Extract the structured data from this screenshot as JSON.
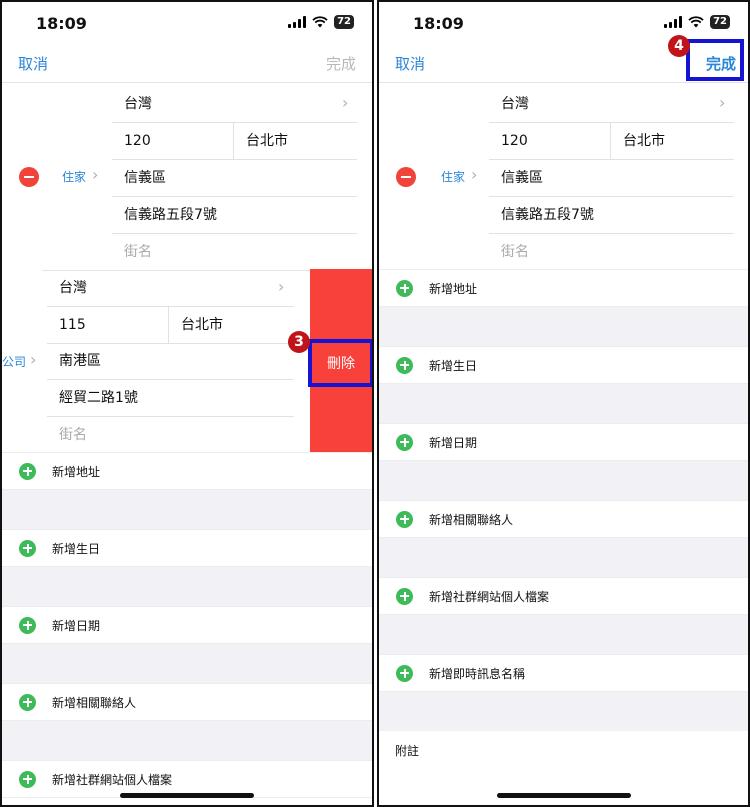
{
  "left": {
    "status": {
      "time": "18:09",
      "battery": "72"
    },
    "nav": {
      "cancel": "取消",
      "done": "完成"
    },
    "home_address": {
      "label": "住家",
      "country": "台灣",
      "postal": "120",
      "city": "台北市",
      "district": "信義區",
      "street": "信義路五段7號",
      "street_placeholder": "街名"
    },
    "work_address": {
      "label": "公司",
      "country": "台灣",
      "postal": "115",
      "city": "台北市",
      "district": "南港區",
      "street": "經貿二路1號",
      "street_placeholder": "街名"
    },
    "delete_label": "刪除",
    "step_badge": "3",
    "add_rows": [
      "新增地址",
      "新增生日",
      "新增日期",
      "新增相關聯絡人",
      "新增社群網站個人檔案"
    ]
  },
  "right": {
    "status": {
      "time": "18:09",
      "battery": "72"
    },
    "nav": {
      "cancel": "取消",
      "done": "完成"
    },
    "step_badge": "4",
    "home_address": {
      "label": "住家",
      "country": "台灣",
      "postal": "120",
      "city": "台北市",
      "district": "信義區",
      "street": "信義路五段7號",
      "street_placeholder": "街名"
    },
    "add_rows": [
      "新增地址",
      "新增生日",
      "新增日期",
      "新增相關聯絡人",
      "新增社群網站個人檔案",
      "新增即時訊息名稱"
    ],
    "notes_label": "附註"
  },
  "colors": {
    "accent": "#2a86d8",
    "delete": "#f8413a",
    "add": "#3fba59",
    "highlight": "#1414d2",
    "badge": "#c0141a"
  }
}
